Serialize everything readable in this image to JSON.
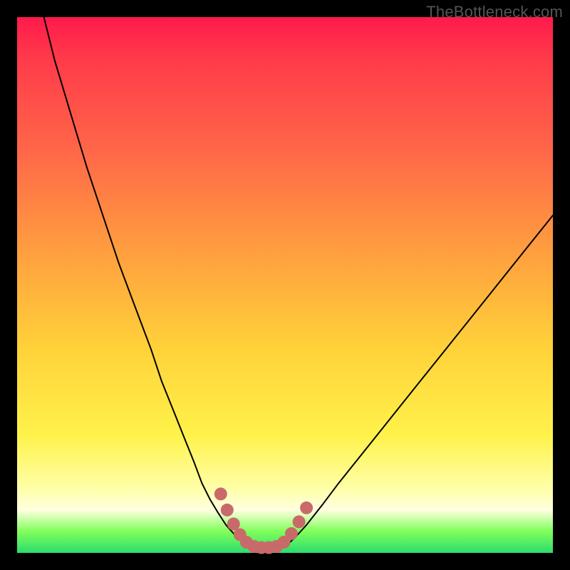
{
  "watermark": {
    "text": "TheBottleneck.com"
  },
  "colors": {
    "frame": "#000000",
    "curve": "#000000",
    "marker": "#c96a6a",
    "gradient_stops": [
      "#ff1a4b",
      "#ff3b4a",
      "#ff6748",
      "#ffa23e",
      "#ffd23a",
      "#fff24a",
      "#ffffa8",
      "#ffffe0",
      "#7fff5a",
      "#2bdc6e"
    ]
  },
  "chart_data": {
    "type": "line",
    "title": "",
    "xlabel": "",
    "ylabel": "",
    "xlim": [
      0,
      100
    ],
    "ylim": [
      0,
      100
    ],
    "grid": false,
    "series": [
      {
        "name": "left-branch",
        "x": [
          5,
          7,
          10,
          13,
          16,
          19,
          22,
          25,
          27,
          29,
          31,
          33,
          34.5,
          36,
          37.5,
          39,
          40.5,
          42,
          43.2
        ],
        "y": [
          100,
          92,
          82,
          72,
          63,
          54,
          46,
          38,
          32,
          27,
          22,
          17,
          13,
          10,
          7.5,
          5.2,
          3.5,
          2.2,
          1.4
        ]
      },
      {
        "name": "valley-floor",
        "x": [
          43.2,
          44.5,
          46,
          47.5,
          49,
          50.3
        ],
        "y": [
          1.4,
          1.0,
          0.9,
          0.9,
          1.0,
          1.4
        ]
      },
      {
        "name": "right-branch",
        "x": [
          50.3,
          52,
          54,
          57,
          60,
          64,
          68,
          72,
          76,
          80,
          84,
          88,
          92,
          96,
          100
        ],
        "y": [
          1.4,
          3.0,
          5.2,
          9,
          13,
          18,
          23,
          28,
          33,
          38,
          43,
          48,
          53,
          58,
          63
        ]
      }
    ],
    "markers": {
      "name": "valley-markers",
      "color": "#c96a6a",
      "radius_pct": 1.2,
      "points": [
        {
          "x": 38.0,
          "y": 11.0
        },
        {
          "x": 39.2,
          "y": 8.0
        },
        {
          "x": 40.4,
          "y": 5.4
        },
        {
          "x": 41.6,
          "y": 3.4
        },
        {
          "x": 42.8,
          "y": 2.0
        },
        {
          "x": 44.2,
          "y": 1.2
        },
        {
          "x": 45.6,
          "y": 1.0
        },
        {
          "x": 47.0,
          "y": 1.0
        },
        {
          "x": 48.4,
          "y": 1.2
        },
        {
          "x": 49.8,
          "y": 2.0
        },
        {
          "x": 51.2,
          "y": 3.6
        },
        {
          "x": 52.6,
          "y": 5.8
        },
        {
          "x": 54.0,
          "y": 8.4
        }
      ]
    }
  }
}
